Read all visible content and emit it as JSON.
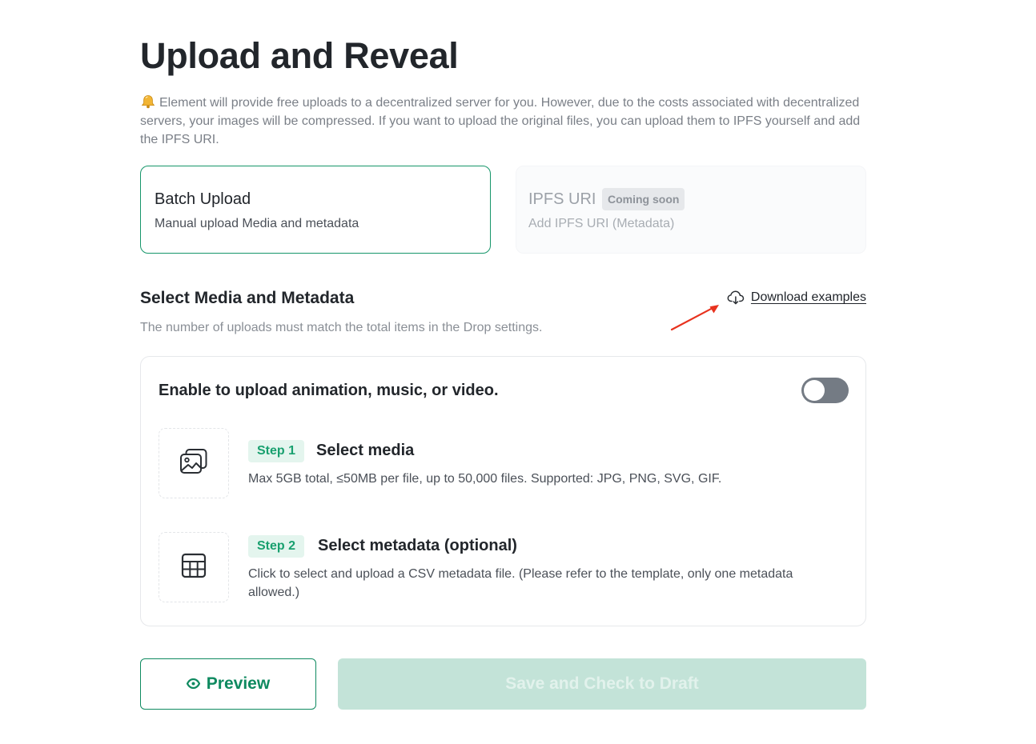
{
  "page": {
    "title": "Upload and Reveal",
    "notice": "Element will provide free uploads to a decentralized server for you. However, due to the costs associated with decentralized servers, your images will be compressed. If you want to upload the original files, you can upload them to IPFS yourself and add the IPFS URI."
  },
  "options": {
    "batch": {
      "title": "Batch Upload",
      "subtitle": "Manual upload Media and metadata",
      "selected": true
    },
    "ipfs": {
      "title": "IPFS URI",
      "badge": "Coming soon",
      "subtitle": "Add IPFS URI (Metadata)",
      "disabled": true
    }
  },
  "section": {
    "title": "Select Media and Metadata",
    "description": "The number of uploads must match the total items in the Drop settings.",
    "download_label": "Download examples"
  },
  "panel": {
    "toggle_label": "Enable to upload animation, music, or video.",
    "toggle_on": false,
    "steps": [
      {
        "badge": "Step 1",
        "title": "Select media",
        "description": "Max 5GB total, ≤50MB per file, up to 50,000 files. Supported: JPG, PNG, SVG, GIF."
      },
      {
        "badge": "Step 2",
        "title": "Select metadata (optional)",
        "description": "Click to select and upload a CSV metadata file. (Please refer to the template, only one metadata allowed.)"
      }
    ]
  },
  "actions": {
    "preview_label": "Preview",
    "save_label": "Save and Check to Draft"
  },
  "icons": {
    "notice": "bell-icon",
    "download": "cloud-download-icon",
    "step1": "images-icon",
    "step2": "table-grid-icon",
    "preview": "eye-icon",
    "annotation": "red-arrow-annotation"
  },
  "colors": {
    "accent": "#16966a",
    "accent_dark": "#0f8a60",
    "badge_bg": "#e4f5ee",
    "toggle_off": "#747b84",
    "save_disabled_bg": "#c3e3d8",
    "annotation_arrow": "#e8321e"
  }
}
